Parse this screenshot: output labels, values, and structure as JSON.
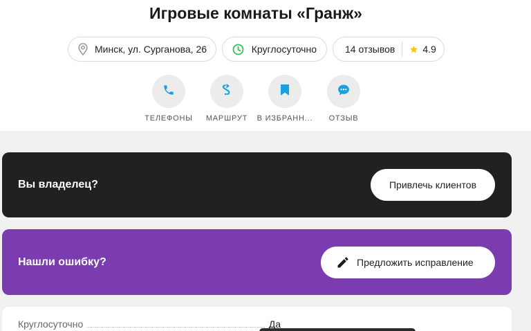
{
  "header": {
    "title": "Игровые комнаты «Гранж»"
  },
  "chips": {
    "address": {
      "icon": "location-pin-icon",
      "text": "Минск, ул. Сурганова, 26"
    },
    "hours": {
      "icon": "clock-icon",
      "text": "Круглосуточно"
    },
    "reviews": {
      "text": "14 отзывов",
      "icon": "star-icon",
      "rating": "4.9"
    }
  },
  "actions": [
    {
      "icon": "phone-icon",
      "label": "Телефоны"
    },
    {
      "icon": "route-icon",
      "label": "Маршрут"
    },
    {
      "icon": "bookmark-icon",
      "label": "В избранн..."
    },
    {
      "icon": "chat-bubble-icon",
      "label": "Отзыв"
    }
  ],
  "owner_card": {
    "question": "Вы владелец?",
    "button": "Привлечь клиентов"
  },
  "error_card": {
    "question": "Нашли ошибку?",
    "button": "Предложить исправление",
    "icon": "pencil-icon"
  },
  "info": {
    "rows": [
      {
        "label": "Круглосуточно",
        "value": "Да"
      }
    ]
  },
  "colors": {
    "accent_blue": "#1a9fe0",
    "clock_green": "#3dbb5f",
    "star_yellow": "#f5c518",
    "owner_card_bg": "#212121",
    "error_card_bg": "#7b3cb0"
  }
}
